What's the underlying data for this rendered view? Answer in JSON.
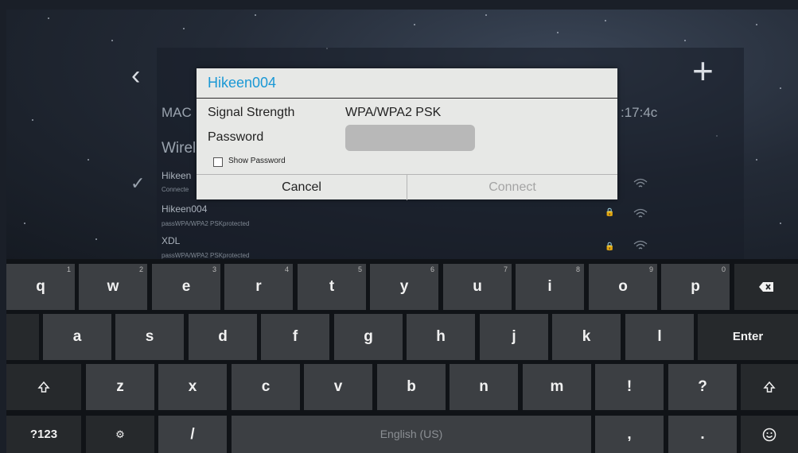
{
  "background": {
    "mac_label": "MAC",
    "mac_value": ":17:4c",
    "wireless_label": "Wirel",
    "networks": [
      {
        "name": "Hikeen",
        "sub": "Connecte"
      },
      {
        "name": "Hikeen004",
        "sub": "passWPA/WPA2 PSKprotected"
      },
      {
        "name": "XDL",
        "sub": "passWPA/WPA2 PSKprotected"
      }
    ]
  },
  "dialog": {
    "title": "Hikeen004",
    "signal_label": "Signal Strength",
    "security_value": "WPA/WPA2 PSK",
    "password_label": "Password",
    "password_value": "",
    "show_password_label": "Show Password",
    "show_password_checked": false,
    "cancel_label": "Cancel",
    "connect_label": "Connect"
  },
  "keyboard": {
    "row1": [
      {
        "label": "q",
        "hint": "1"
      },
      {
        "label": "w",
        "hint": "2"
      },
      {
        "label": "e",
        "hint": "3"
      },
      {
        "label": "r",
        "hint": "4"
      },
      {
        "label": "t",
        "hint": "5"
      },
      {
        "label": "y",
        "hint": "6"
      },
      {
        "label": "u",
        "hint": "7"
      },
      {
        "label": "i",
        "hint": "8"
      },
      {
        "label": "o",
        "hint": "9"
      },
      {
        "label": "p",
        "hint": "0"
      }
    ],
    "row2": [
      "a",
      "s",
      "d",
      "f",
      "g",
      "h",
      "j",
      "k",
      "l"
    ],
    "enter_label": "Enter",
    "row3": [
      "z",
      "x",
      "c",
      "v",
      "b",
      "n",
      "m",
      "!",
      "?"
    ],
    "symbols_label": "?123",
    "slash_label": "/",
    "space_label": "English (US)",
    "comma_label": ",",
    "period_label": ".",
    "backspace_icon": "backspace-icon",
    "shift_icon": "shift-icon",
    "emoji_icon": "emoji-icon",
    "settings_icon": "keyboard-settings-icon"
  }
}
